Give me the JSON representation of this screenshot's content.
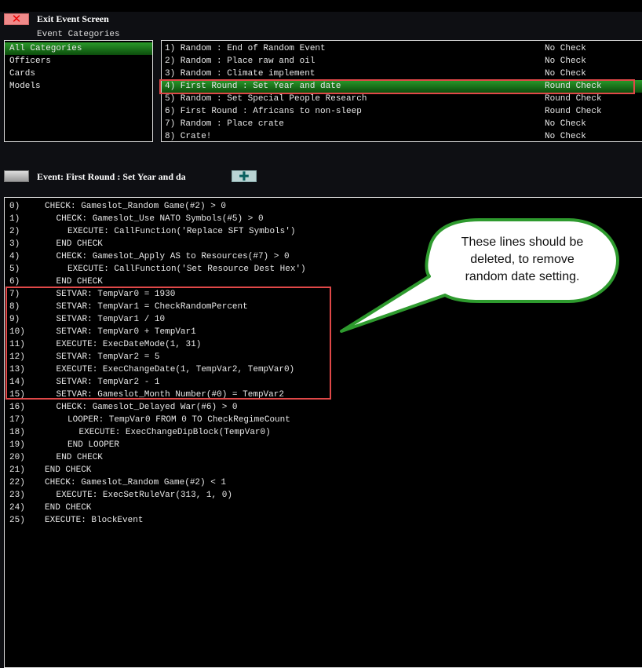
{
  "header": {
    "exit_label": "Exit Event Screen",
    "categories_label": "Event Categories"
  },
  "categories": [
    {
      "label": "All Categories",
      "selected": true
    },
    {
      "label": "Officers"
    },
    {
      "label": "Cards"
    },
    {
      "label": "Models"
    }
  ],
  "events": [
    {
      "label": "1) Random : End of Random Event",
      "check": "No Check"
    },
    {
      "label": "2) Random : Place raw and oil",
      "check": "No Check"
    },
    {
      "label": "3) Random : Climate implement",
      "check": "No Check"
    },
    {
      "label": "4) First Round : Set Year and date",
      "check": "Round Check",
      "selected": true
    },
    {
      "label": "5) Random : Set Special People Research",
      "check": "Round Check"
    },
    {
      "label": "6) First Round : Africans to non-sleep",
      "check": "Round Check"
    },
    {
      "label": "7) Random : Place crate",
      "check": "No Check"
    },
    {
      "label": "8) Crate!",
      "check": "No Check"
    }
  ],
  "event_title": "Event: First Round : Set Year and da",
  "add_icon": "plus-icon",
  "script": [
    {
      "n": "0)",
      "t": "CHECK: Gameslot_Random Game(#2) > 0",
      "i": 0
    },
    {
      "n": "1)",
      "t": "CHECK: Gameslot_Use NATO Symbols(#5) > 0",
      "i": 1
    },
    {
      "n": "2)",
      "t": "EXECUTE: CallFunction('Replace SFT Symbols')",
      "i": 2
    },
    {
      "n": "3)",
      "t": "END CHECK",
      "i": 1
    },
    {
      "n": "4)",
      "t": "CHECK: Gameslot_Apply AS to Resources(#7) > 0",
      "i": 1
    },
    {
      "n": "5)",
      "t": "EXECUTE: CallFunction('Set Resource Dest Hex')",
      "i": 2
    },
    {
      "n": "6)",
      "t": "END CHECK",
      "i": 1
    },
    {
      "n": "7)",
      "t": "SETVAR: TempVar0 = 1930",
      "i": 1
    },
    {
      "n": "8)",
      "t": "SETVAR: TempVar1 = CheckRandomPercent",
      "i": 1
    },
    {
      "n": "9)",
      "t": "SETVAR: TempVar1 / 10",
      "i": 1
    },
    {
      "n": "10)",
      "t": "SETVAR: TempVar0 + TempVar1",
      "i": 1
    },
    {
      "n": "11)",
      "t": "EXECUTE: ExecDateMode(1, 31)",
      "i": 1
    },
    {
      "n": "12)",
      "t": "SETVAR: TempVar2 = 5",
      "i": 1
    },
    {
      "n": "13)",
      "t": "EXECUTE: ExecChangeDate(1, TempVar2, TempVar0)",
      "i": 1
    },
    {
      "n": "14)",
      "t": "SETVAR: TempVar2 - 1",
      "i": 1
    },
    {
      "n": "15)",
      "t": "SETVAR: Gameslot_Month Number(#0) = TempVar2",
      "i": 1
    },
    {
      "n": "16)",
      "t": "CHECK: Gameslot_Delayed War(#6) > 0",
      "i": 1
    },
    {
      "n": "17)",
      "t": "LOOPER: TempVar0 FROM 0 TO CheckRegimeCount",
      "i": 2
    },
    {
      "n": "18)",
      "t": "EXECUTE: ExecChangeDipBlock(TempVar0)",
      "i": 3
    },
    {
      "n": "19)",
      "t": "END LOOPER",
      "i": 2
    },
    {
      "n": "20)",
      "t": "END CHECK",
      "i": 1
    },
    {
      "n": "21)",
      "t": "END CHECK",
      "i": 0
    },
    {
      "n": "22)",
      "t": "CHECK: Gameslot_Random Game(#2) < 1",
      "i": 0
    },
    {
      "n": "23)",
      "t": "EXECUTE: ExecSetRuleVar(313, 1, 0)",
      "i": 1
    },
    {
      "n": "24)",
      "t": "END CHECK",
      "i": 0
    },
    {
      "n": "25)",
      "t": "EXECUTE: BlockEvent",
      "i": 0
    }
  ],
  "callout": {
    "lines": [
      "These lines should be",
      "deleted, to remove",
      "random date setting."
    ]
  },
  "colors": {
    "highlight": "#e04848",
    "callout_border": "#2e9a2e",
    "selection": "#1f7f1f"
  }
}
